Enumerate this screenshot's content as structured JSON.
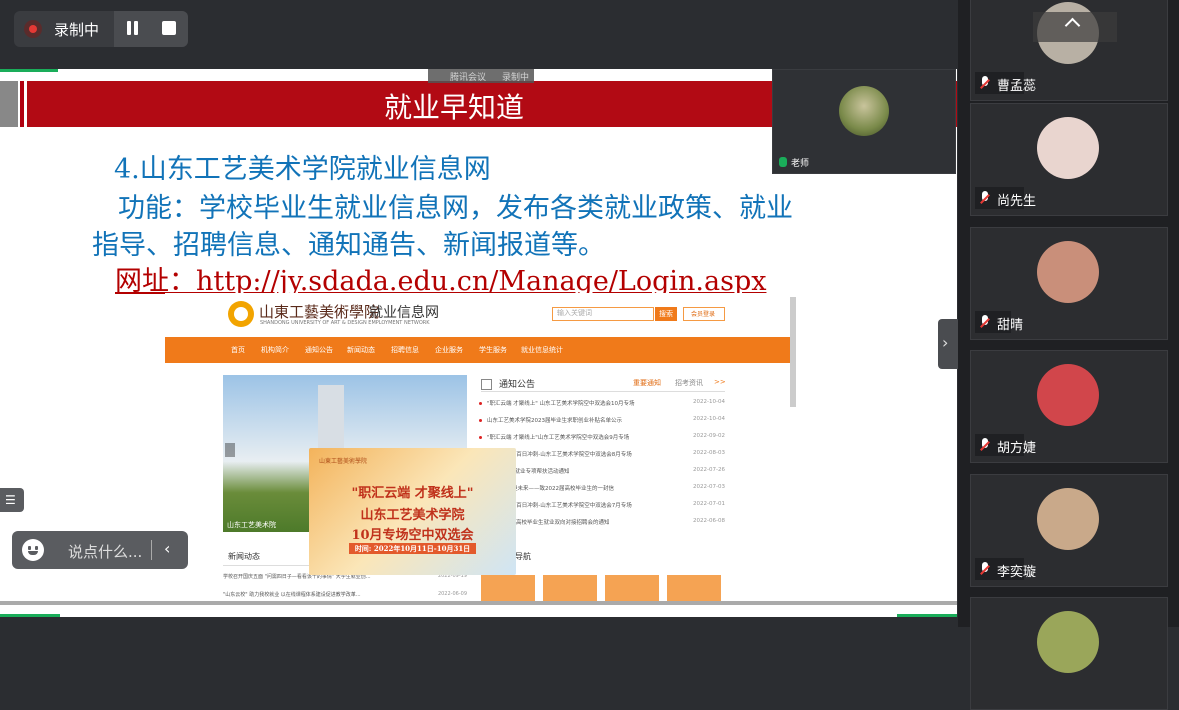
{
  "recording": {
    "label": "录制中"
  },
  "slide": {
    "banner_title": "就业早知道",
    "meeting_tag_left": "腾讯会议",
    "meeting_tag_right": "录制中",
    "line1": "4.山东工艺美术学院就业信息网",
    "line2": "功能：学校毕业生就业信息网，发布各类就业政策、就业",
    "line3": "指导、招聘信息、通知通告、新闻报道等。",
    "line4": "网址：http://jy.sdada.edu.cn/Manage/Login.aspx"
  },
  "site": {
    "school": "山東工藝美術學院",
    "name": "就业信息网",
    "english": "SHANDONG UNIVERSITY OF ART & DESIGN EMPLOYMENT NETWORK",
    "search_placeholder": "输入关键词",
    "search_btn": "搜索",
    "login": "会员登录",
    "nav": [
      "首页",
      "机构简介",
      "通知公告",
      "新闻动态",
      "招聘信息",
      "企业服务",
      "学生服务",
      "就业信息统计"
    ],
    "photo_caption": "山东工艺美术院",
    "notice_title": "通知公告",
    "notice_tabs": [
      "重要通知",
      "招考资讯",
      ">>"
    ],
    "notices": [
      {
        "title": "\"职汇云端 才聚线上\" 山东工艺美术学院空中双选会10月专场",
        "date": "2022-10-04"
      },
      {
        "title": "山东工艺美术学院2023届毕业生求职创业补贴名单公示",
        "date": "2022-10-04"
      },
      {
        "title": "\"职汇云端 才聚线上\"山东工艺美术学院空中双选会9月专场",
        "date": "2022-09-02"
      },
      {
        "title": "…战略护航 百日冲刺-山东工艺美术学院空中双选会8月专场",
        "date": "2022-08-03"
      },
      {
        "title": "…生质校未就业专项帮扶活动通知",
        "date": "2022-07-26"
      },
      {
        "title": "…东 \"就\" 但未来——致2022届高校毕业生的一封信",
        "date": "2022-07-03"
      },
      {
        "title": "…战略护航 百日冲刺-山东工艺美术学院空中双选会7月专场",
        "date": "2022-07-01"
      },
      {
        "title": "…22年山东高校毕业生就业双向对接招聘会的通知",
        "date": "2022-06-08"
      }
    ],
    "news_title": "新闻动态",
    "nav_title": "导航",
    "news": [
      {
        "title": "学校召开国庆五面 \"问需四日子—看看该干的事情\" 大学生就业创...",
        "date": "2022-09-19"
      },
      {
        "title": "\"山东云校\" 助力我校就业 以在线课程体系建设促进教学改革...",
        "date": "2022-06-09"
      }
    ]
  },
  "promo": {
    "logo": "山東工藝美術學院",
    "line1": "\"职汇云端 才聚线上\"",
    "line2": "山东工艺美术学院",
    "line3": "10月专场空中双选会",
    "line4": "时间: 2022年10月11日-10月31日"
  },
  "main_tile": {
    "name": "老师"
  },
  "participants": [
    {
      "name": "曹孟蕊",
      "avatar": "#b8b0a4"
    },
    {
      "name": "尚先生",
      "avatar": "#e9d5cf"
    },
    {
      "name": "甜晴",
      "avatar": "#c98f7a"
    },
    {
      "name": "胡方婕",
      "avatar": "#d1464b"
    },
    {
      "name": "李奕璇",
      "avatar": "#c9a98a"
    },
    {
      "name": "",
      "avatar": "#9aa65a"
    }
  ],
  "chat": {
    "placeholder": "说点什么..."
  },
  "colors": {
    "accent": "#f07a1a",
    "banner": "#b20a14",
    "slide_text": "#1173b8",
    "url_text": "#b30000"
  }
}
